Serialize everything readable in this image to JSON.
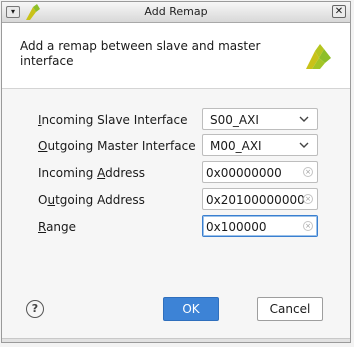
{
  "window": {
    "title": "Add Remap",
    "menu_glyph": "▾",
    "close_glyph": "✕",
    "logo_icon": "vivado-logo-icon"
  },
  "header": {
    "description": "Add a remap between slave and master interface",
    "logo_icon": "vivado-logo-icon"
  },
  "form": {
    "incoming_slave": {
      "label_u": "I",
      "label_rest": "ncoming Slave Interface",
      "value": "S00_AXI"
    },
    "outgoing_master": {
      "label_u": "O",
      "label_rest": "utgoing Master Interface",
      "value": "M00_AXI"
    },
    "incoming_address": {
      "label_pre": "Incoming ",
      "label_u": "A",
      "label_rest": "ddress",
      "value": "0x00000000"
    },
    "outgoing_address": {
      "label_pre": "O",
      "label_u": "u",
      "label_rest": "tgoing Address",
      "value": "0x20100000000"
    },
    "range": {
      "label_u": "R",
      "label_rest": "ange",
      "value": "0x100000"
    }
  },
  "buttons": {
    "help": "?",
    "ok": "OK",
    "cancel": "Cancel"
  },
  "colors": {
    "ok_button": "#3d83d6",
    "focus_border": "#3a7fd0",
    "logo_yellow": "#c9c219",
    "logo_green": "#8dbf28"
  }
}
